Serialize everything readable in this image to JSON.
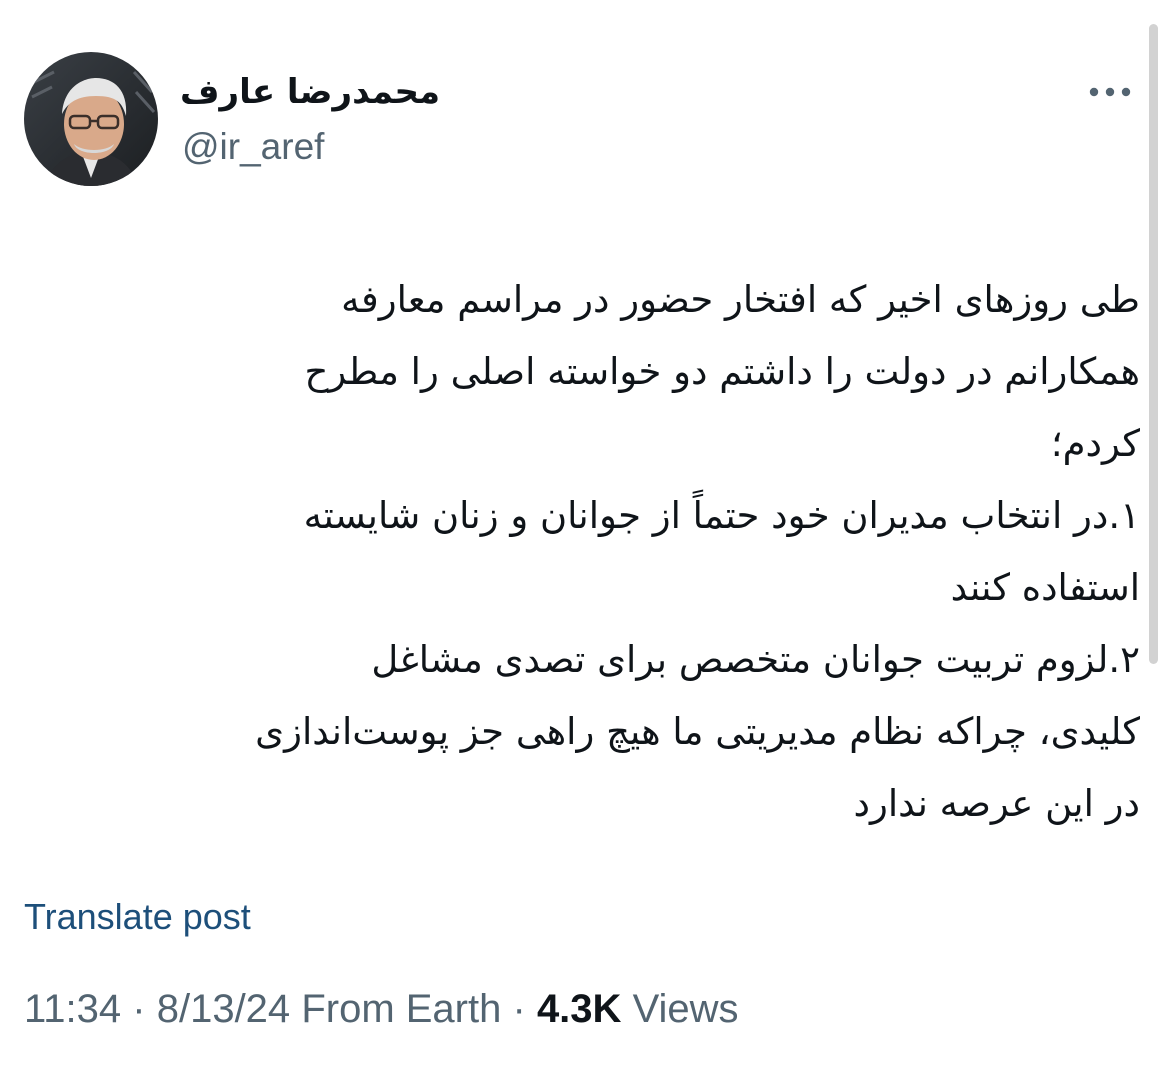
{
  "author": {
    "display_name": "محمدرضا عارف",
    "handle": "@ir_aref"
  },
  "more_icon": "more-horizontal-icon",
  "tweet": {
    "lines": [
      "طی روزهای اخیر که افتخار حضور در مراسم معارفه",
      "همکارانم در دولت را داشتم دو خواسته اصلی را مطرح",
      "کردم؛",
      "۱.در انتخاب مدیران خود حتماً از جوانان و زنان شایسته",
      "استفاده کنند",
      "۲.لزوم تربیت جوانان متخصص برای تصدی مشاغل",
      "کلیدی، چراکه نظام مدیریتی ما هیچ راهی جز پوست‌اندازی",
      "در این عرصه ندارد"
    ]
  },
  "translate_label": "Translate post",
  "meta": {
    "time": "11:34",
    "separator": "·",
    "date": "8/13/24",
    "source": "From Earth",
    "views_count": "4.3K",
    "views_label": "Views"
  },
  "colors": {
    "text": "#0f1419",
    "secondary": "#536471",
    "link": "#1d4f7a"
  }
}
